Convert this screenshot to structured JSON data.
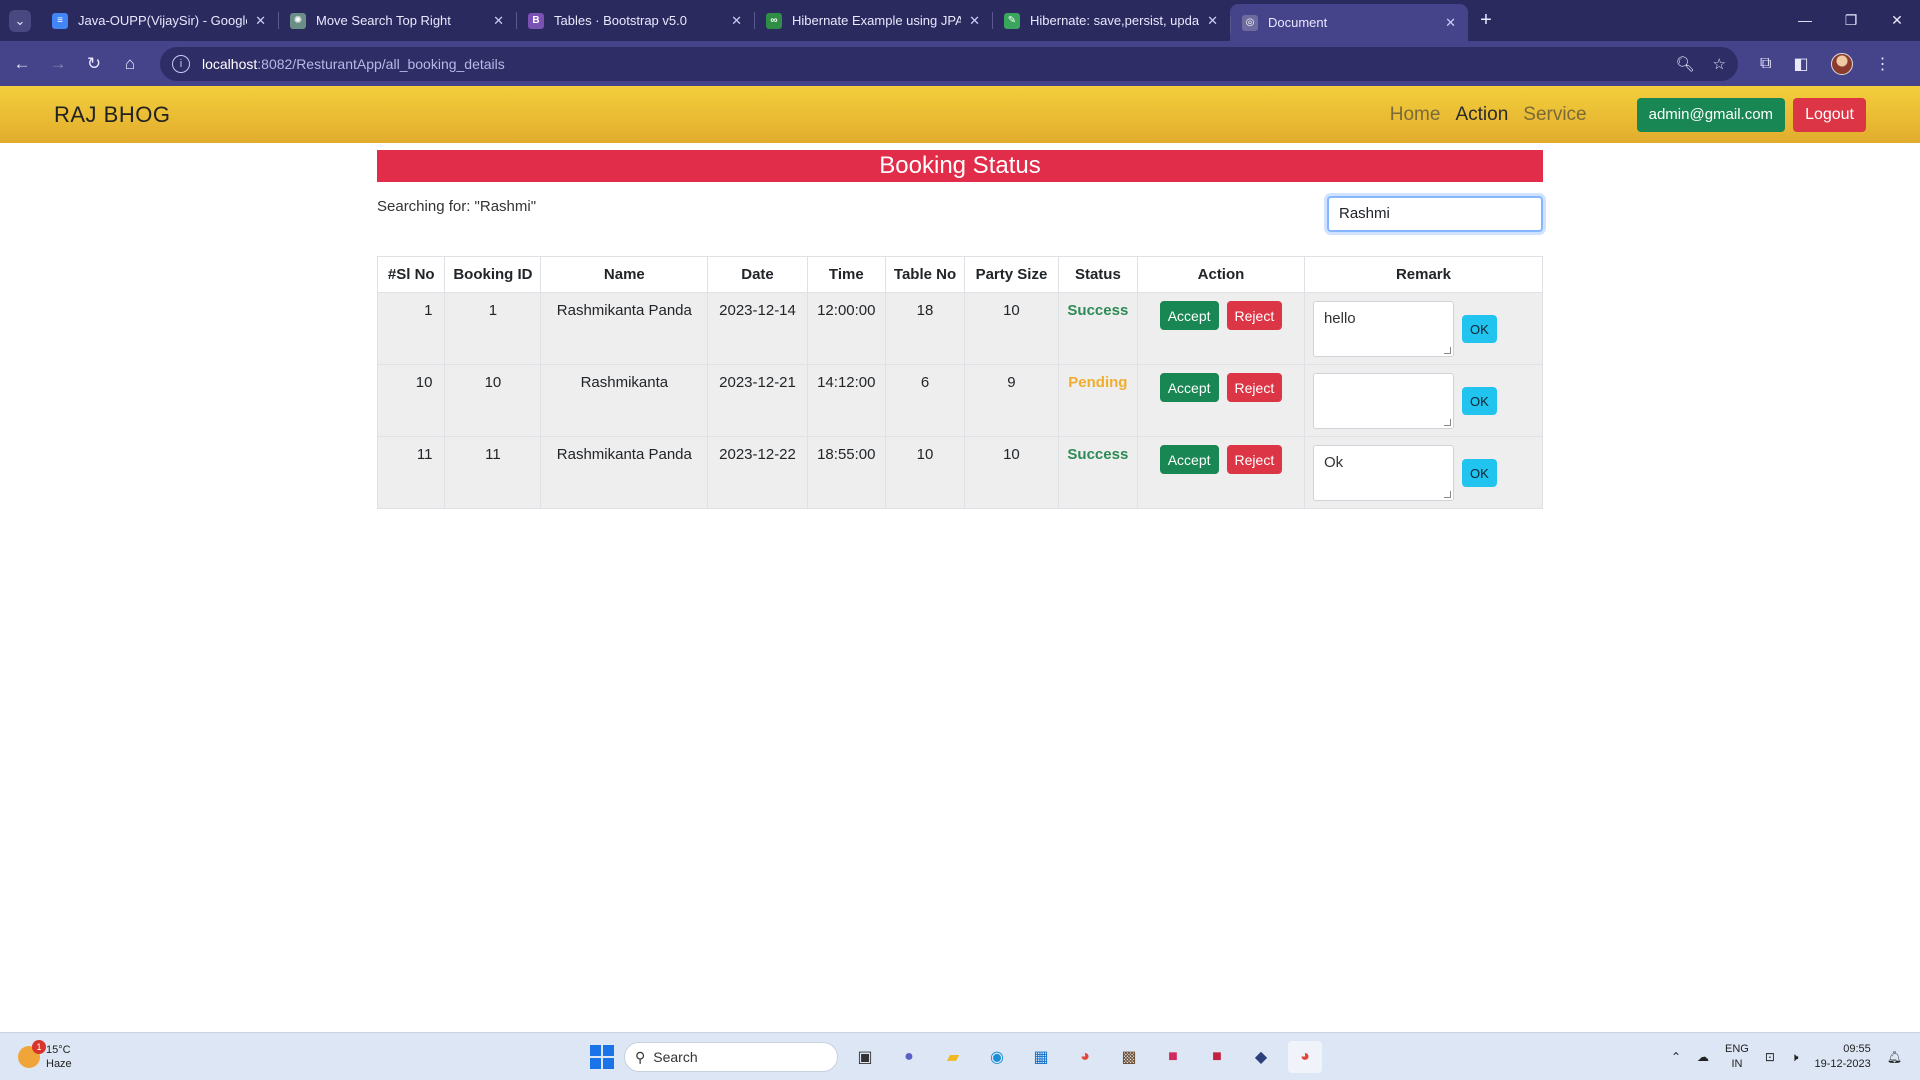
{
  "browser": {
    "tabs": [
      {
        "title": "Java-OUPP(VijaySir) - Google D",
        "favicon": "docs-icon",
        "color": "#4285f4",
        "glyph": "≡"
      },
      {
        "title": "Move Search Top Right",
        "favicon": "chatgpt-icon",
        "color": "#6b8f87",
        "glyph": "✺"
      },
      {
        "title": "Tables · Bootstrap v5.0",
        "favicon": "bootstrap-icon",
        "color": "#7952b3",
        "glyph": "B"
      },
      {
        "title": "Hibernate Example using JPA ar",
        "favicon": "gfg-icon",
        "color": "#2f8d46",
        "glyph": "∞"
      },
      {
        "title": "Hibernate: save,persist, update,",
        "favicon": "bookmark-icon",
        "color": "#3aa55c",
        "glyph": "✎"
      },
      {
        "title": "Document",
        "favicon": "globe-icon",
        "color": "#6e6c9e",
        "glyph": "◎"
      }
    ],
    "url_host": "localhost",
    "url_path": ":8082/ResturantApp/all_booking_details"
  },
  "site": {
    "brand": "RAJ BHOG",
    "nav": [
      "Home",
      "Action",
      "Service"
    ],
    "active_nav": "Action",
    "user_email": "admin@gmail.com",
    "logout_label": "Logout"
  },
  "page": {
    "title": "Booking Status",
    "searching_text": "Searching for: \"Rashmi\"",
    "search_value": "Rashmi"
  },
  "table": {
    "headers": [
      "#Sl No",
      "Booking ID",
      "Name",
      "Date",
      "Time",
      "Table No",
      "Party Size",
      "Status",
      "Action",
      "Remark"
    ],
    "accept_label": "Accept",
    "reject_label": "Reject",
    "ok_label": "OK",
    "rows": [
      {
        "sl": "1",
        "id": "1",
        "name": "Rashmikanta Panda",
        "date": "2023-12-14",
        "time": "12:00:00",
        "table": "18",
        "party": "10",
        "status": "Success",
        "remark": "hello"
      },
      {
        "sl": "10",
        "id": "10",
        "name": "Rashmikanta",
        "date": "2023-12-21",
        "time": "14:12:00",
        "table": "6",
        "party": "9",
        "status": "Pending",
        "remark": ""
      },
      {
        "sl": "11",
        "id": "11",
        "name": "Rashmikanta Panda",
        "date": "2023-12-22",
        "time": "18:55:00",
        "table": "10",
        "party": "10",
        "status": "Success",
        "remark": "Ok"
      }
    ]
  },
  "taskbar": {
    "weather_temp": "15°C",
    "weather_desc": "Haze",
    "weather_badge": "1",
    "search_label": "Search",
    "lang_top": "ENG",
    "lang_bottom": "IN",
    "time": "09:55",
    "date": "19-12-2023"
  },
  "colors": {
    "navbar_gradient_top": "#f3cf3c",
    "banner": "#e12c4a",
    "success": "#198754",
    "danger": "#dc3545",
    "info": "#20c4ee"
  }
}
